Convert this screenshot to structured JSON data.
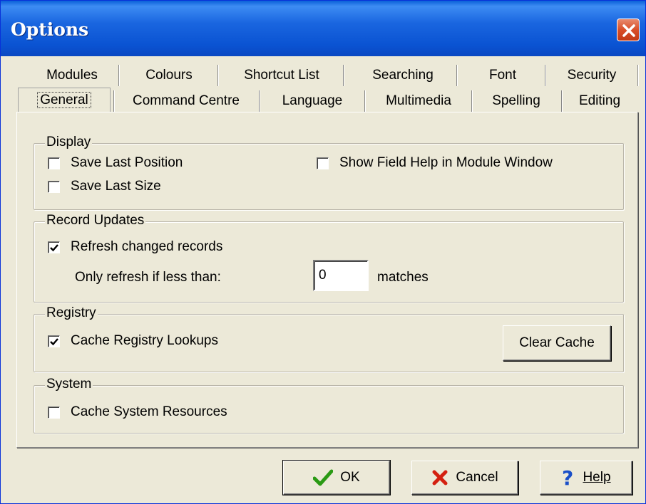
{
  "window": {
    "title": "Options"
  },
  "tabs_row1": [
    "Modules",
    "Colours",
    "Shortcut List",
    "Searching",
    "Font",
    "Security"
  ],
  "tabs_row2": [
    "General",
    "Command Centre",
    "Language",
    "Multimedia",
    "Spelling",
    "Editing"
  ],
  "active_tab": "General",
  "display": {
    "label": "Display",
    "save_last_position": {
      "label": "Save Last Position",
      "checked": false
    },
    "save_last_size": {
      "label": "Save Last Size",
      "checked": false
    },
    "show_field_help": {
      "label": "Show Field Help in Module Window",
      "checked": false
    }
  },
  "record_updates": {
    "label": "Record Updates",
    "refresh_changed": {
      "label": "Refresh changed records",
      "checked": true
    },
    "only_refresh_label": "Only refresh if less than:",
    "refresh_value": "0",
    "matches_label": "matches"
  },
  "registry": {
    "label": "Registry",
    "cache_lookups": {
      "label": "Cache Registry Lookups",
      "checked": true
    },
    "clear_cache_label": "Clear Cache"
  },
  "system": {
    "label": "System",
    "cache_resources": {
      "label": "Cache System Resources",
      "checked": false
    }
  },
  "buttons": {
    "ok": "OK",
    "cancel": "Cancel",
    "help": "Help"
  },
  "colors": {
    "titlebar": "#0a53d2",
    "face": "#ece9d8",
    "ok_check": "#2a9a14",
    "cancel_x": "#d42010",
    "help_q": "#1a4fc8"
  }
}
